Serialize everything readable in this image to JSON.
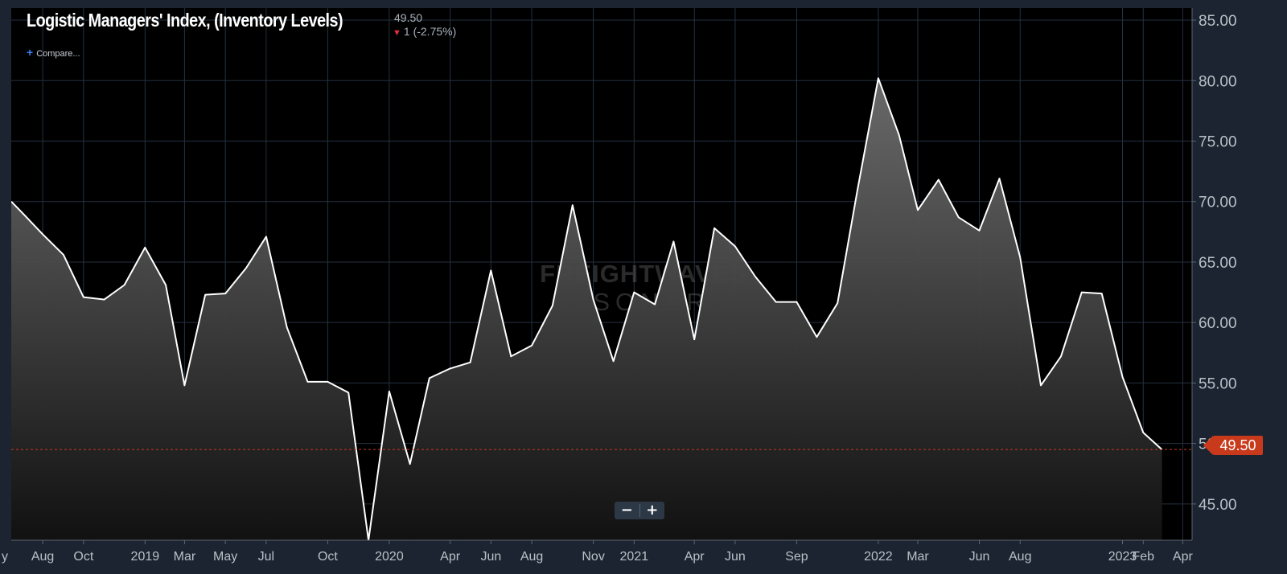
{
  "header": {
    "title": "Logistic Managers' Index, (Inventory Levels)",
    "last_value": "49.50",
    "change": "1 (-2.75%)",
    "compare_label": "Compare..."
  },
  "zoom": {
    "out_label": "−",
    "in_label": "+"
  },
  "watermark": {
    "line1": "FREIGHTWAVES",
    "line2": "SONAR"
  },
  "last_badge": "49.50",
  "colors": {
    "background": "#1b2430",
    "plot_background": "#000000",
    "line": "#ffffff",
    "area_top": "#6e6e6e",
    "area_bottom": "#111111",
    "gridline": "#243140",
    "badge": "#c93a1c",
    "down_arrow": "#e0303a",
    "compare_plus": "#3b82f6"
  },
  "chart_data": {
    "type": "area",
    "title": "Logistic Managers' Index, (Inventory Levels)",
    "xlabel": "",
    "ylabel": "",
    "ylim": [
      42,
      86
    ],
    "xlim": [
      "2018-06-15",
      "2023-04-15"
    ],
    "y_ticks": [
      "45.00",
      "50.00",
      "55.00",
      "60.00",
      "65.00",
      "70.00",
      "75.00",
      "80.00",
      "85.00"
    ],
    "x_ticks": [
      {
        "label": "y",
        "date": "2018-06-01"
      },
      {
        "label": "Aug",
        "date": "2018-08-01"
      },
      {
        "label": "Oct",
        "date": "2018-10-01"
      },
      {
        "label": "2019",
        "date": "2019-01-01"
      },
      {
        "label": "Mar",
        "date": "2019-03-01"
      },
      {
        "label": "May",
        "date": "2019-05-01"
      },
      {
        "label": "Jul",
        "date": "2019-07-01"
      },
      {
        "label": "Oct",
        "date": "2019-10-01"
      },
      {
        "label": "2020",
        "date": "2020-01-01"
      },
      {
        "label": "Apr",
        "date": "2020-04-01"
      },
      {
        "label": "Jun",
        "date": "2020-06-01"
      },
      {
        "label": "Aug",
        "date": "2020-08-01"
      },
      {
        "label": "Nov",
        "date": "2020-11-01"
      },
      {
        "label": "2021",
        "date": "2021-01-01"
      },
      {
        "label": "Apr",
        "date": "2021-04-01"
      },
      {
        "label": "Jun",
        "date": "2021-06-01"
      },
      {
        "label": "Sep",
        "date": "2021-09-01"
      },
      {
        "label": "2022",
        "date": "2022-01-01"
      },
      {
        "label": "Mar",
        "date": "2022-03-01"
      },
      {
        "label": "Jun",
        "date": "2022-06-01"
      },
      {
        "label": "Aug",
        "date": "2022-08-01"
      },
      {
        "label": "2023",
        "date": "2023-01-01"
      },
      {
        "label": "Feb",
        "date": "2023-02-01"
      },
      {
        "label": "Apr",
        "date": "2023-04-01"
      }
    ],
    "grid": true,
    "last_value_line": 49.5,
    "series": [
      {
        "points": [
          [
            "2018-06-15",
            70.0
          ],
          [
            "2018-07-01",
            69.1
          ],
          [
            "2018-08-01",
            67.3
          ],
          [
            "2018-09-01",
            65.6
          ],
          [
            "2018-10-01",
            62.1
          ],
          [
            "2018-11-01",
            61.9
          ],
          [
            "2018-12-01",
            63.1
          ],
          [
            "2019-01-01",
            66.2
          ],
          [
            "2019-02-01",
            63.1
          ],
          [
            "2019-03-01",
            54.8
          ],
          [
            "2019-04-01",
            62.3
          ],
          [
            "2019-05-01",
            62.4
          ],
          [
            "2019-06-01",
            64.5
          ],
          [
            "2019-07-01",
            67.1
          ],
          [
            "2019-08-01",
            59.6
          ],
          [
            "2019-09-01",
            55.1
          ],
          [
            "2019-10-01",
            55.1
          ],
          [
            "2019-11-01",
            54.2
          ],
          [
            "2019-12-01",
            42.0
          ],
          [
            "2020-01-01",
            54.3
          ],
          [
            "2020-02-01",
            48.3
          ],
          [
            "2020-03-01",
            55.4
          ],
          [
            "2020-04-01",
            56.2
          ],
          [
            "2020-05-01",
            56.7
          ],
          [
            "2020-06-01",
            64.3
          ],
          [
            "2020-07-01",
            57.2
          ],
          [
            "2020-08-01",
            58.1
          ],
          [
            "2020-09-01",
            61.4
          ],
          [
            "2020-10-01",
            69.7
          ],
          [
            "2020-11-01",
            61.9
          ],
          [
            "2020-12-01",
            56.8
          ],
          [
            "2021-01-01",
            62.5
          ],
          [
            "2021-02-01",
            61.5
          ],
          [
            "2021-03-01",
            66.7
          ],
          [
            "2021-04-01",
            58.6
          ],
          [
            "2021-05-01",
            67.8
          ],
          [
            "2021-06-01",
            66.3
          ],
          [
            "2021-07-01",
            63.8
          ],
          [
            "2021-08-01",
            61.7
          ],
          [
            "2021-09-01",
            61.7
          ],
          [
            "2021-10-01",
            58.8
          ],
          [
            "2021-11-01",
            61.6
          ],
          [
            "2021-12-01",
            71.0
          ],
          [
            "2022-01-01",
            80.2
          ],
          [
            "2022-02-01",
            75.5
          ],
          [
            "2022-03-01",
            69.3
          ],
          [
            "2022-04-01",
            71.8
          ],
          [
            "2022-05-01",
            68.7
          ],
          [
            "2022-06-01",
            67.6
          ],
          [
            "2022-07-01",
            71.9
          ],
          [
            "2022-08-01",
            65.4
          ],
          [
            "2022-09-01",
            54.8
          ],
          [
            "2022-10-01",
            57.2
          ],
          [
            "2022-11-01",
            62.5
          ],
          [
            "2022-12-01",
            62.4
          ],
          [
            "2023-01-01",
            55.5
          ],
          [
            "2023-02-01",
            50.9
          ],
          [
            "2023-03-01",
            49.5
          ]
        ]
      }
    ]
  }
}
